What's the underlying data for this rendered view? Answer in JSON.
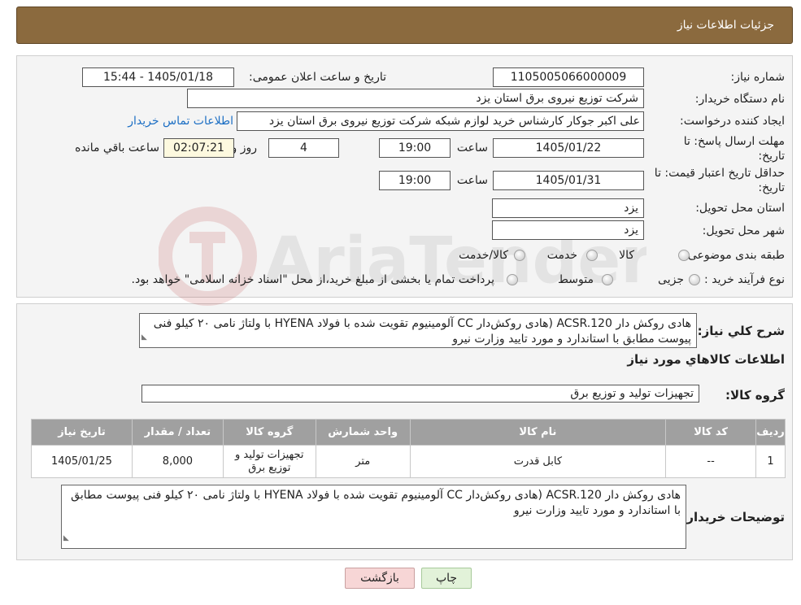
{
  "header": {
    "title": "جزئیات اطلاعات نیاز"
  },
  "form": {
    "need_number_label": "شماره نیاز:",
    "need_number": "1105005066000009",
    "announce_label": "تاریخ و ساعت اعلان عمومی:",
    "announce_value": "1405/01/18 - 15:44",
    "buyer_label": "نام دستگاه خریدار:",
    "buyer_value": "شرکت توزیع نیروی برق استان یزد",
    "creator_label": "ایجاد کننده درخواست:",
    "creator_value": "علی اکبر  جوکار  کارشناس خرید لوازم شبکه  شرکت توزیع نیروی برق استان یزد",
    "contact_link": "اطلاعات تماس خریدار",
    "deadline_label_1": "مهلت ارسال پاسخ: تا",
    "deadline_label_2": "تاریخ:",
    "deadline_date": "1405/01/22",
    "time_label": "ساعت",
    "deadline_time": "19:00",
    "days_value": "4",
    "days_label": "روز و",
    "remaining_time": "02:07:21",
    "remaining_label": "ساعت باقي مانده",
    "validity_label_1": "حداقل تاریخ اعتبار قیمت: تا",
    "validity_label_2": "تاریخ:",
    "validity_date": "1405/01/31",
    "validity_time": "19:00",
    "province_label": "استان محل تحویل:",
    "province_value": "یزد",
    "city_label": "شهر محل تحویل:",
    "city_value": "یزد",
    "category_label": "طبقه بندی موضوعی:",
    "category_options": [
      "کالا",
      "خدمت",
      "کالا/خدمت"
    ],
    "process_label": "نوع فرآیند خرید :",
    "process_options": [
      "جزیی",
      "متوسط"
    ],
    "process_note": "پرداخت تمام یا بخشی از مبلغ خرید،از محل \"اسناد خزانه اسلامی\" خواهد بود."
  },
  "watermark": {
    "text": "AriaTender.neT"
  },
  "details": {
    "summary_label": "شرح کلي نياز:",
    "summary_text": "هادی روکش دار ACSR.120 (هادی روکش‌دار CC آلومینیوم تقویت شده با فولاد HYENA با ولتاژ نامی ۲۰ کیلو فنی پیوست مطابق با استاندارد و مورد تایید وزارت نیرو",
    "goods_info_title": "اطلاعات کالاهاي مورد نياز",
    "group_label": "گروه کالا:",
    "group_value": "تجهیزات تولید و توزیع برق",
    "table": {
      "headers": [
        "ردیف",
        "کد کالا",
        "نام کالا",
        "واحد شمارش",
        "گروه کالا",
        "تعداد / مقدار",
        "تاریخ نیاز"
      ],
      "rows": [
        [
          "1",
          "--",
          "کابل قدرت",
          "متر",
          "تجهیزات تولید و توزیع برق",
          "8,000",
          "1405/01/25"
        ]
      ]
    },
    "buyer_notes_label": "توضیحات خریدار:",
    "buyer_notes_text": "هادی روکش دار ACSR.120 (هادی روکش‌دار CC آلومینیوم تقویت شده با فولاد HYENA با ولتاژ نامی ۲۰ کیلو فنی پیوست مطابق با استاندارد و مورد تایید وزارت نیرو"
  },
  "buttons": {
    "print": "چاپ",
    "back": "بازگشت"
  }
}
